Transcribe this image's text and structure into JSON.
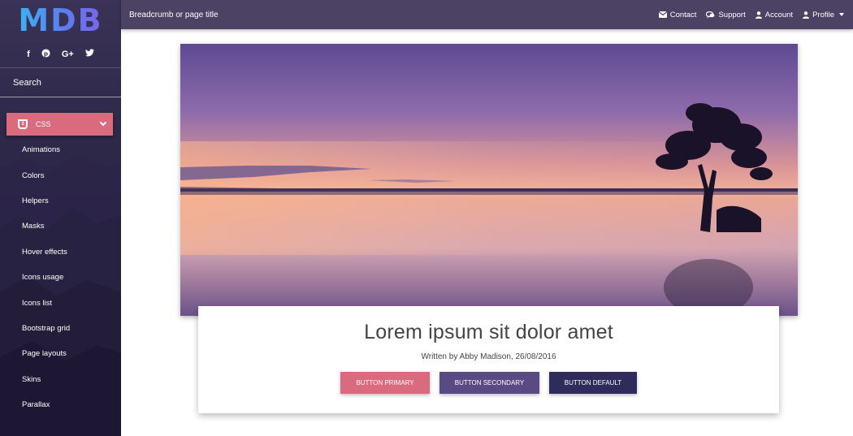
{
  "sidebar": {
    "logo": "MDB",
    "social": [
      {
        "icon": "facebook-icon",
        "glyph": "f"
      },
      {
        "icon": "pinterest-icon",
        "glyph": "℗"
      },
      {
        "icon": "google-plus-icon",
        "glyph": "G+"
      },
      {
        "icon": "twitter-icon",
        "glyph": "🐦"
      }
    ],
    "search_placeholder": "Search",
    "css_section_label": "CSS",
    "items": [
      {
        "label": "Animations"
      },
      {
        "label": "Colors"
      },
      {
        "label": "Helpers"
      },
      {
        "label": "Masks"
      },
      {
        "label": "Hover effects"
      },
      {
        "label": "Icons usage"
      },
      {
        "label": "Icons list"
      },
      {
        "label": "Bootstrap grid"
      },
      {
        "label": "Page layouts"
      },
      {
        "label": "Skins"
      },
      {
        "label": "Parallax"
      }
    ]
  },
  "topbar": {
    "breadcrumb": "Breadcrumb or page title",
    "nav": [
      {
        "label": "Contact",
        "icon": "envelope-icon"
      },
      {
        "label": "Support",
        "icon": "comments-icon"
      },
      {
        "label": "Account",
        "icon": "user-icon"
      },
      {
        "label": "Profile",
        "icon": "user-icon"
      }
    ]
  },
  "card": {
    "title": "Lorem ipsum sit dolor amet",
    "byline": "Written by Abby Madison, 26/08/2016",
    "buttons": {
      "primary": "Button Primary",
      "secondary": "Button Secondary",
      "default": "Button Default"
    }
  },
  "colors": {
    "primary": "#da6a7e",
    "secondary": "#5a4a84",
    "default": "#2f2c5c",
    "topbar": "#4c4364"
  }
}
